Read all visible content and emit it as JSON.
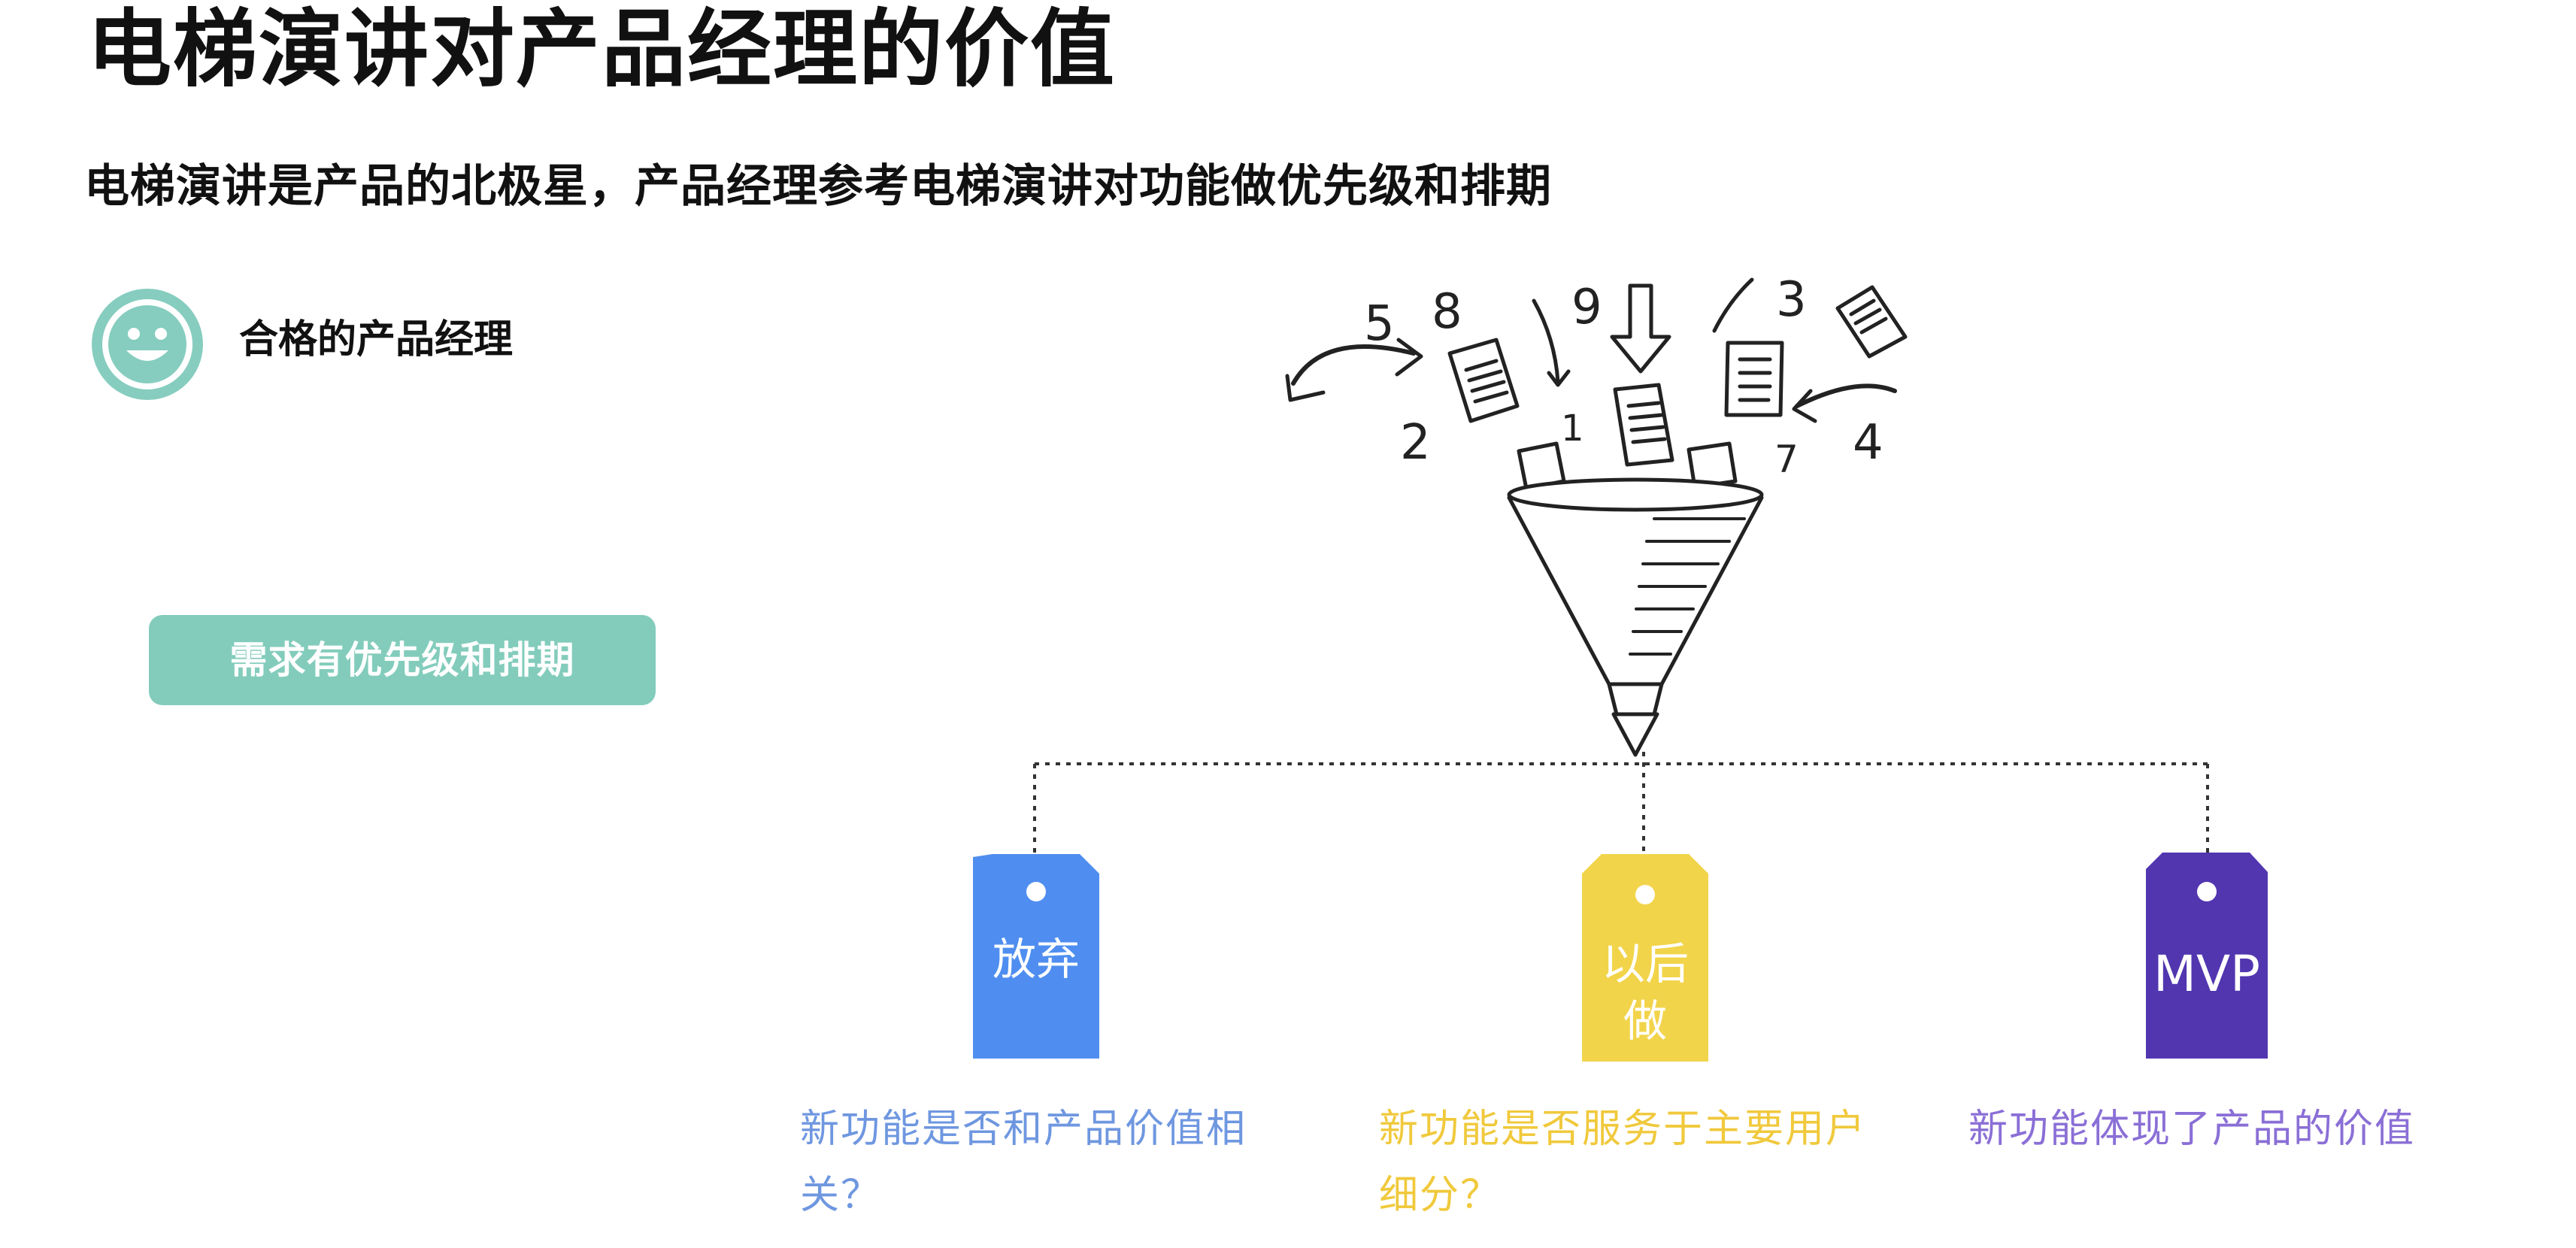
{
  "title": "电梯演讲对产品经理的价值",
  "subtitle": "电梯演讲是产品的北极星，产品经理参考电梯演讲对功能做优先级和排期",
  "persona": {
    "icon": "smiley-face-icon",
    "label": "合格的产品经理"
  },
  "pill_label": "需求有优先级和排期",
  "funnel": {
    "icon": "funnel-illustration",
    "numbers": [
      "5",
      "8",
      "9",
      "3",
      "2",
      "1",
      "4",
      "7"
    ]
  },
  "tags": [
    {
      "label": "放弃",
      "color": "#4f8ef0",
      "description": "新功能是否和产品价值相关？"
    },
    {
      "label": "以后做",
      "color": "#f2d44a",
      "description": "新功能是否服务于主要用户细分？"
    },
    {
      "label": "MVP",
      "color": "#5136b0",
      "description": "新功能体现了产品的价值"
    }
  ],
  "desc_colors": [
    "#6f97e0",
    "#f0c93c",
    "#8a6fd6"
  ]
}
